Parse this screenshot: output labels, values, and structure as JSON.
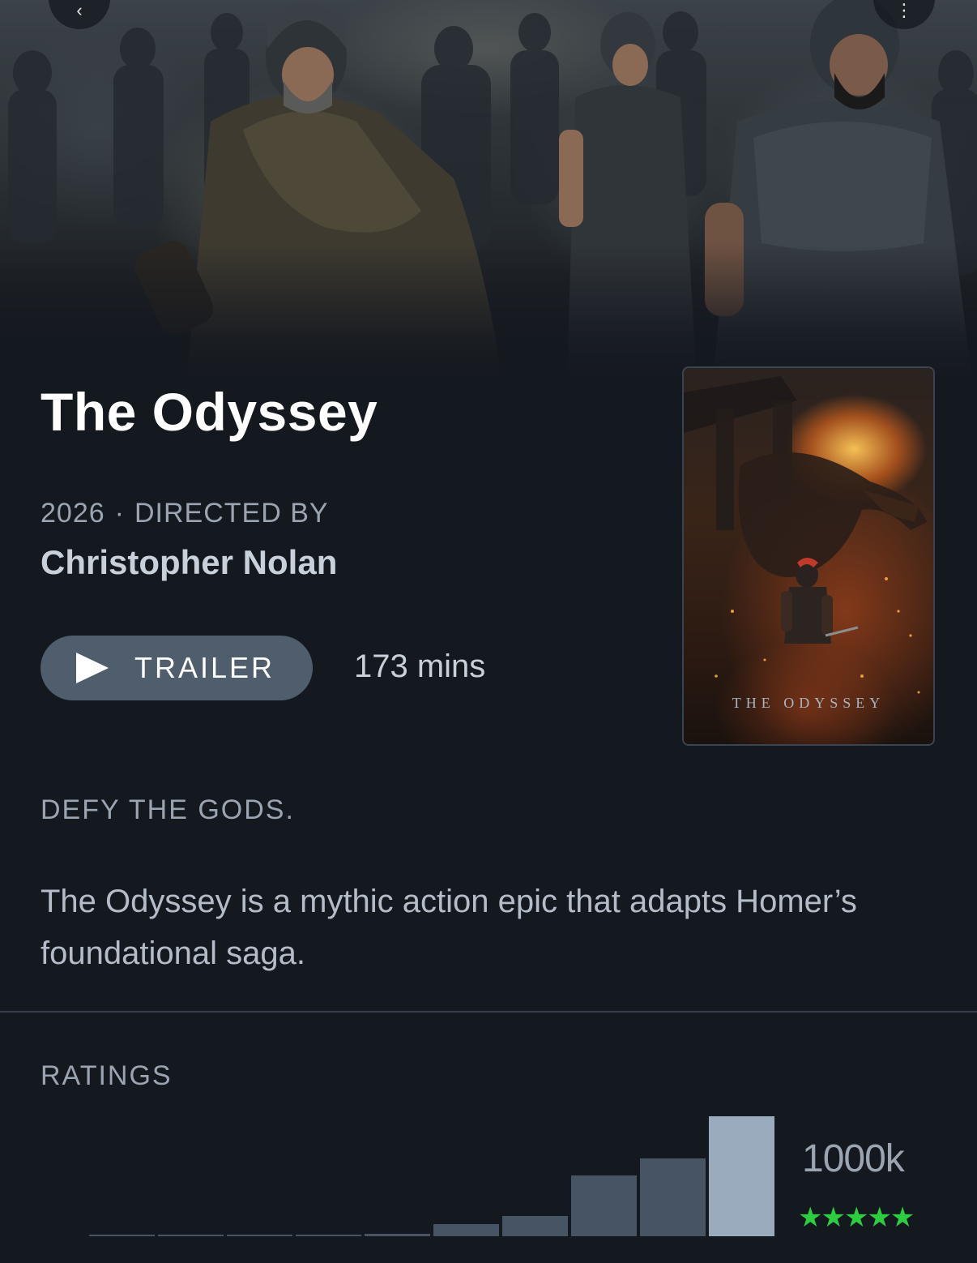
{
  "movie": {
    "title": "The Odyssey",
    "year": "2026",
    "directed_by_label": "DIRECTED BY",
    "director": "Christopher Nolan",
    "runtime": "173 mins",
    "tagline": "DEFY THE GODS.",
    "overview": "The Odyssey is a mythic action epic that adapts Homer’s foundational saga.",
    "poster_title": "THE ODYSSEY"
  },
  "actions": {
    "trailer_label": "TRAILER"
  },
  "icons": {
    "back": "chevron-left-icon",
    "more": "more-vertical-icon",
    "play": "play-icon",
    "star": "star-icon"
  },
  "ratings": {
    "heading": "RATINGS",
    "total_count": "1000k",
    "stars": "★★★★★",
    "star_color": "#2ecc40",
    "histogram_relative": [
      0.01,
      0.01,
      0.01,
      0.01,
      0.02,
      0.1,
      0.17,
      0.51,
      0.65,
      1.0
    ]
  },
  "colors": {
    "background": "#14181f",
    "button": "#4f5d6d",
    "bar": "#465464",
    "bar_highlight": "#9aabbd"
  }
}
